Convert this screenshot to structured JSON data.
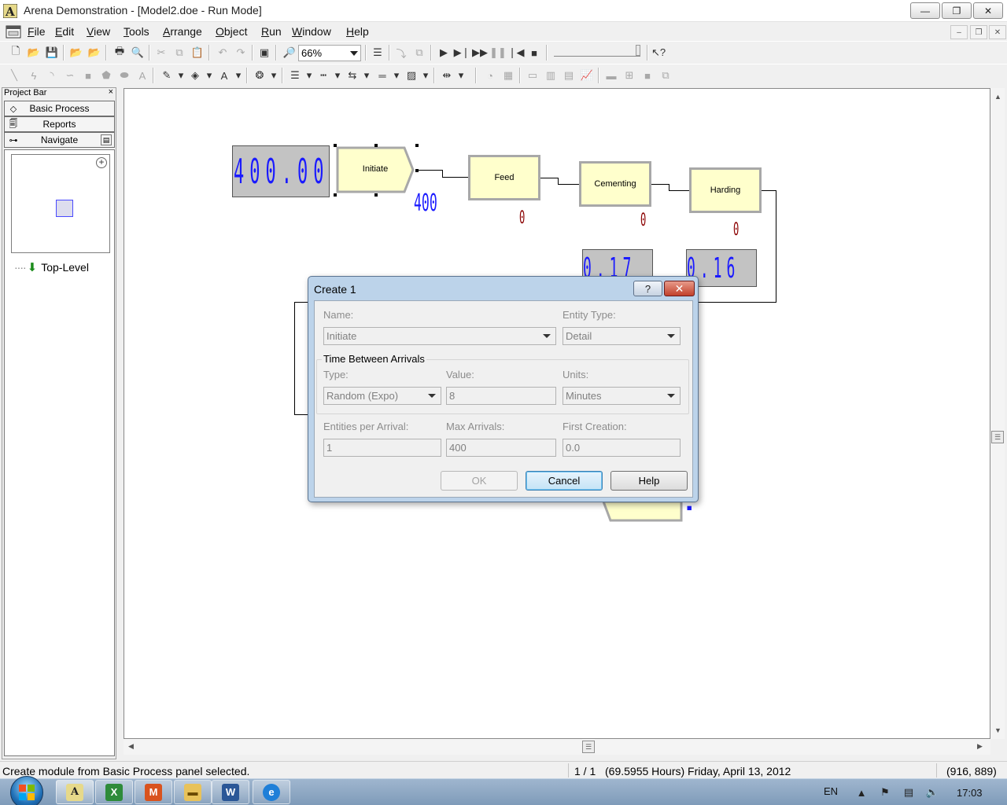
{
  "window": {
    "title": "Arena Demonstration - [Model2.doe - Run Mode]",
    "minimize": "—",
    "maximize": "❐",
    "close": "✕"
  },
  "menu": [
    "File",
    "Edit",
    "View",
    "Tools",
    "Arrange",
    "Object",
    "Run",
    "Window",
    "Help"
  ],
  "mdi": {
    "minimize": "–",
    "restore": "❐",
    "close": "✕"
  },
  "toolbar": {
    "zoom_value": "66%"
  },
  "project_bar": {
    "title": "Project Bar",
    "close": "×",
    "panels": [
      "Basic Process",
      "Reports",
      "Navigate"
    ],
    "tree_item": "Top-Level"
  },
  "canvas": {
    "modules": {
      "initiate": "Initiate",
      "feed": "Feed",
      "cementing": "Cementing",
      "harding": "Harding"
    },
    "displays": {
      "main": "400.00",
      "cementing_util": "0.17",
      "harding_util": "0.16"
    },
    "counters": {
      "initiate": "400",
      "feed": "0",
      "cementing": "0",
      "harding": "0"
    }
  },
  "dialog": {
    "title": "Create 1",
    "help_btn": "?",
    "close_btn": "✕",
    "name_label": "Name:",
    "name_value": "Initiate",
    "entity_type_label": "Entity Type:",
    "entity_type_value": "Detail",
    "group_title": "Time Between Arrivals",
    "type_label": "Type:",
    "type_value": "Random (Expo)",
    "value_label": "Value:",
    "value_value": "8",
    "units_label": "Units:",
    "units_value": "Minutes",
    "entities_label": "Entities per Arrival:",
    "entities_value": "1",
    "max_label": "Max Arrivals:",
    "max_value": "400",
    "first_label": "First Creation:",
    "first_value": "0.0",
    "ok": "OK",
    "cancel": "Cancel",
    "help": "Help"
  },
  "status": {
    "message": "Create module from Basic Process panel selected.",
    "replication": "1 / 1",
    "sim_time": "(69.5955 Hours) Friday, April 13, 2012",
    "coords": "(916, 889)"
  },
  "taskbar": {
    "lang": "EN",
    "clock": "17:03"
  }
}
